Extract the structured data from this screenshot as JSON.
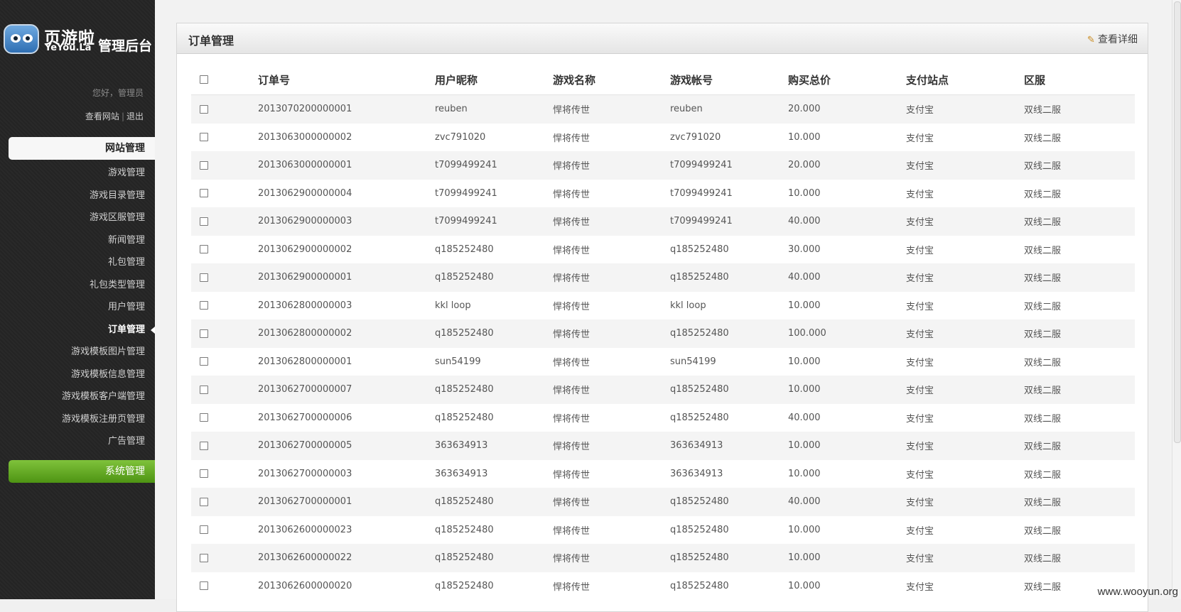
{
  "sidebar": {
    "logo_cn": "页游啦",
    "logo_en": "YeYou.La",
    "logo_admin": "管理后台",
    "greeting": "您好，管理员",
    "link_view_site": "查看网站",
    "link_separator": "|",
    "link_logout": "退出",
    "section_site": "网站管理",
    "items": [
      {
        "label": "游戏管理"
      },
      {
        "label": "游戏目录管理"
      },
      {
        "label": "游戏区服管理"
      },
      {
        "label": "新闻管理"
      },
      {
        "label": "礼包管理"
      },
      {
        "label": "礼包类型管理"
      },
      {
        "label": "用户管理"
      },
      {
        "label": "订单管理"
      },
      {
        "label": "游戏模板图片管理"
      },
      {
        "label": "游戏模板信息管理"
      },
      {
        "label": "游戏模板客户端管理"
      },
      {
        "label": "游戏模板注册页管理"
      },
      {
        "label": "广告管理"
      }
    ],
    "active_item": "订单管理",
    "section_system": "系统管理"
  },
  "panel": {
    "title": "订单管理",
    "detail_link": "查看详细"
  },
  "table": {
    "headers": [
      "订单号",
      "用户昵称",
      "游戏名称",
      "游戏帐号",
      "购买总价",
      "支付站点",
      "区服"
    ],
    "rows": [
      [
        "2013070200000001",
        "reuben",
        "悍将传世",
        "reuben",
        "20.000",
        "支付宝",
        "双线二服"
      ],
      [
        "2013063000000002",
        "zvc791020",
        "悍将传世",
        "zvc791020",
        "10.000",
        "支付宝",
        "双线二服"
      ],
      [
        "2013063000000001",
        "t7099499241",
        "悍将传世",
        "t7099499241",
        "20.000",
        "支付宝",
        "双线二服"
      ],
      [
        "2013062900000004",
        "t7099499241",
        "悍将传世",
        "t7099499241",
        "10.000",
        "支付宝",
        "双线二服"
      ],
      [
        "2013062900000003",
        "t7099499241",
        "悍将传世",
        "t7099499241",
        "40.000",
        "支付宝",
        "双线二服"
      ],
      [
        "2013062900000002",
        "q185252480",
        "悍将传世",
        "q185252480",
        "30.000",
        "支付宝",
        "双线二服"
      ],
      [
        "2013062900000001",
        "q185252480",
        "悍将传世",
        "q185252480",
        "40.000",
        "支付宝",
        "双线二服"
      ],
      [
        "2013062800000003",
        "kkl loop",
        "悍将传世",
        "kkl loop",
        "10.000",
        "支付宝",
        "双线二服"
      ],
      [
        "2013062800000002",
        "q185252480",
        "悍将传世",
        "q185252480",
        "100.000",
        "支付宝",
        "双线二服"
      ],
      [
        "2013062800000001",
        "sun54199",
        "悍将传世",
        "sun54199",
        "10.000",
        "支付宝",
        "双线二服"
      ],
      [
        "2013062700000007",
        "q185252480",
        "悍将传世",
        "q185252480",
        "10.000",
        "支付宝",
        "双线二服"
      ],
      [
        "2013062700000006",
        "q185252480",
        "悍将传世",
        "q185252480",
        "40.000",
        "支付宝",
        "双线二服"
      ],
      [
        "2013062700000005",
        "363634913",
        "悍将传世",
        "363634913",
        "10.000",
        "支付宝",
        "双线二服"
      ],
      [
        "2013062700000003",
        "363634913",
        "悍将传世",
        "363634913",
        "10.000",
        "支付宝",
        "双线二服"
      ],
      [
        "2013062700000001",
        "q185252480",
        "悍将传世",
        "q185252480",
        "40.000",
        "支付宝",
        "双线二服"
      ],
      [
        "2013062600000023",
        "q185252480",
        "悍将传世",
        "q185252480",
        "10.000",
        "支付宝",
        "双线二服"
      ],
      [
        "2013062600000022",
        "q185252480",
        "悍将传世",
        "q185252480",
        "10.000",
        "支付宝",
        "双线二服"
      ],
      [
        "2013062600000020",
        "q185252480",
        "悍将传世",
        "q185252480",
        "10.000",
        "支付宝",
        "双线二服"
      ]
    ]
  },
  "watermark": "www.wooyun.org",
  "icons": {
    "detail_link_icon": "pencil-icon",
    "logo_icon": "mascot-logo-icon"
  },
  "colors": {
    "sidebar_bg": "#262626",
    "system_button": "#62a81f",
    "row_stripe": "#f4f4f4"
  }
}
